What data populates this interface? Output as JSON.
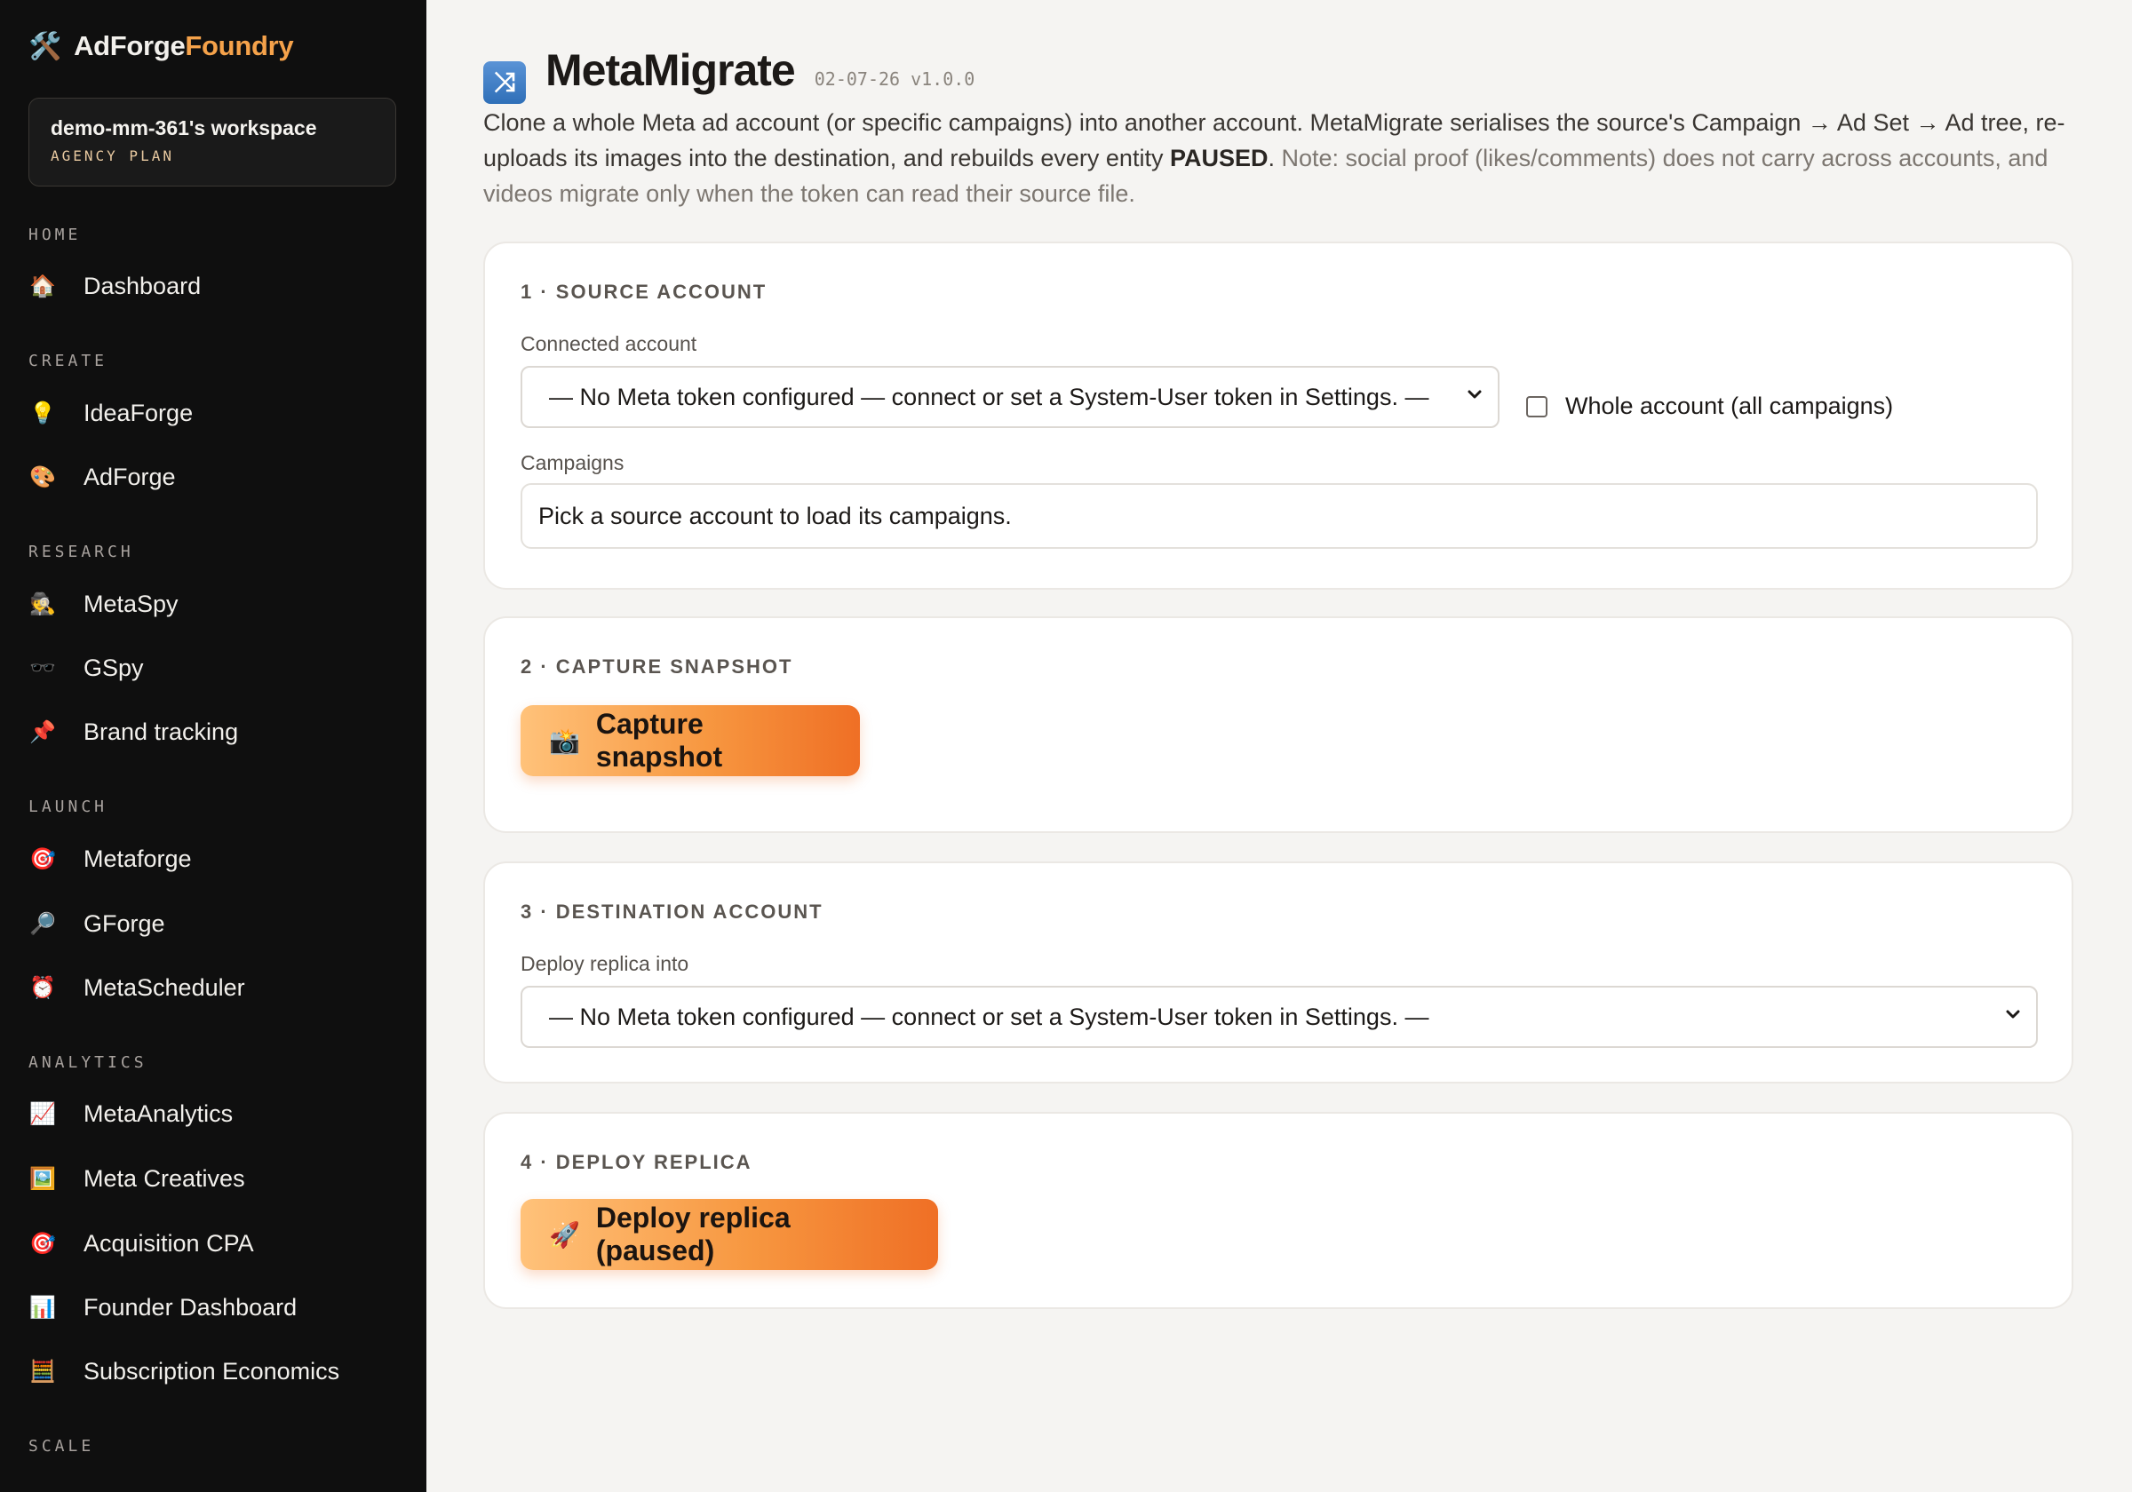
{
  "sidebar": {
    "brand": {
      "icon": "hammer-wrench-icon",
      "name_part1": "AdForge",
      "name_part2": "Foundry",
      "accent_color": "#f5a24a"
    },
    "workspace": {
      "name": "demo-mm-361's workspace",
      "plan": "AGENCY PLAN"
    },
    "sections": {
      "home": "HOME",
      "create": "CREATE",
      "research": "RESEARCH",
      "launch": "LAUNCH",
      "analytics": "ANALYTICS",
      "scale": "SCALE"
    },
    "items": {
      "dashboard": {
        "label": "Dashboard",
        "icon": "house-icon"
      },
      "ideaforge": {
        "label": "IdeaForge",
        "icon": "lightbulb-icon"
      },
      "adforge": {
        "label": "AdForge",
        "icon": "palette-icon"
      },
      "metaspy": {
        "label": "MetaSpy",
        "icon": "detective-icon"
      },
      "gspy": {
        "label": "GSpy",
        "icon": "sunglasses-icon"
      },
      "brand_tracking": {
        "label": "Brand tracking",
        "icon": "pushpin-icon"
      },
      "metaforge": {
        "label": "Metaforge",
        "icon": "target-icon"
      },
      "gforge": {
        "label": "GForge",
        "icon": "magnifier-icon"
      },
      "metascheduler": {
        "label": "MetaScheduler",
        "icon": "alarm-clock-icon"
      },
      "metaanalytics": {
        "label": "MetaAnalytics",
        "icon": "chart-up-icon"
      },
      "meta_creatives": {
        "label": "Meta Creatives",
        "icon": "framed-picture-icon"
      },
      "acquisition_cpa": {
        "label": "Acquisition CPA",
        "icon": "target-icon"
      },
      "founder_dashboard": {
        "label": "Founder Dashboard",
        "icon": "bar-chart-icon"
      },
      "subscription_economics": {
        "label": "Subscription Economics",
        "icon": "abacus-icon"
      }
    }
  },
  "header": {
    "icon": "shuffle-icon",
    "title": "MetaMigrate",
    "version": "02-07-26 v1.0.0"
  },
  "intro": {
    "part1": "Clone a whole Meta ad account (or specific campaigns) into another account. MetaMigrate serialises the source's Campaign → Ad Set → Ad tree, re-uploads its images into the destination, and rebuilds every entity ",
    "paused": "PAUSED",
    "part2": ". ",
    "note": "Note: social proof (likes/comments) does not carry across accounts, and videos migrate only when the token can read their source file."
  },
  "step1": {
    "title": "1 · SOURCE ACCOUNT",
    "connected_label": "Connected account",
    "connected_value": "— No Meta token configured — connect or set a System-User token in Settings. —",
    "whole_account_label": "Whole account (all campaigns)",
    "campaigns_label": "Campaigns",
    "campaigns_placeholder": "Pick a source account to load its campaigns."
  },
  "step2": {
    "title": "2 · CAPTURE SNAPSHOT",
    "button_label": "Capture snapshot",
    "button_icon": "camera-flash-icon"
  },
  "step3": {
    "title": "3 · DESTINATION ACCOUNT",
    "deploy_label": "Deploy replica into",
    "deploy_value": "— No Meta token configured — connect or set a System-User token in Settings. —"
  },
  "step4": {
    "title": "4 · DEPLOY REPLICA",
    "button_label": "Deploy replica (paused)",
    "button_icon": "rocket-icon"
  }
}
